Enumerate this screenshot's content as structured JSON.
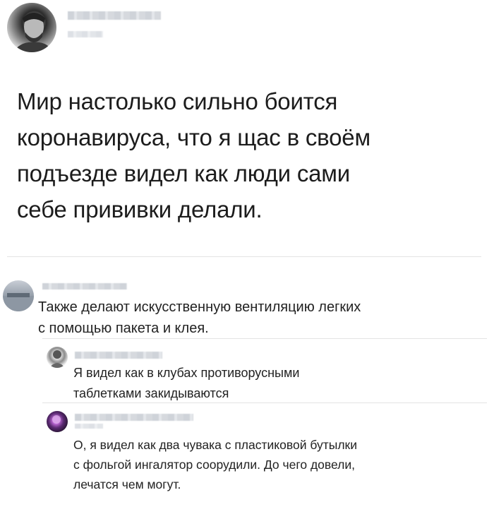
{
  "post": {
    "author_name": "",
    "text": "Мир настолько сильно боится\nкоронавируса, что я щас в своём\nподъезде видел как люди сами\nсебе прививки делали."
  },
  "comments": [
    {
      "text": "Также делают искусственную вентиляцию легких\nс помощью пакета и клея."
    },
    {
      "text": "Я видел как в клубах противорусными\n таблетками закидываются"
    },
    {
      "text": "О, я видел как два чувака с пластиковой бутылки\nс фольгой ингалятор соорудили. До чего довели,\nлечатся чем могут."
    }
  ]
}
